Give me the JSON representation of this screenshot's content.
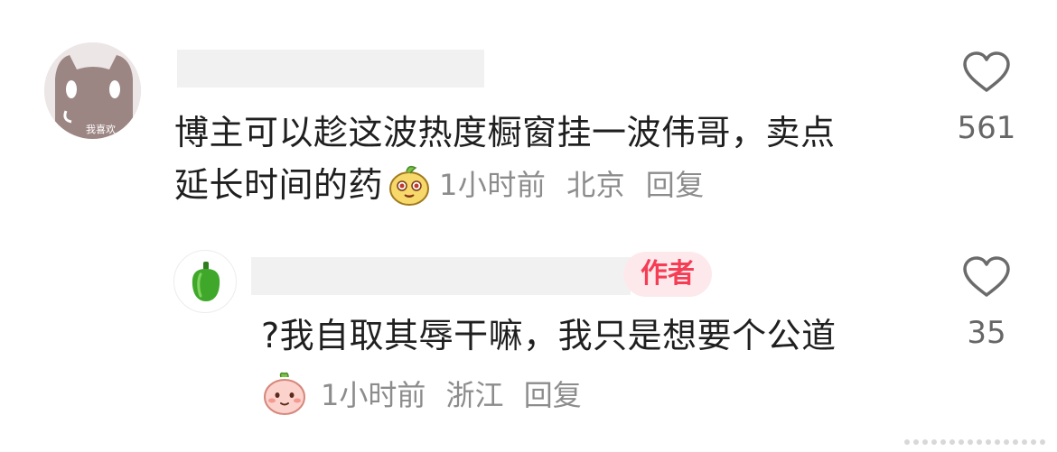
{
  "comments": [
    {
      "avatar_caption": "我喜欢",
      "text_line1": "博主可以趁这波热度橱窗挂一波伟哥，卖点",
      "text_line2": "延长时间的药",
      "emoji": "yellow-blob-emoji",
      "time": "1小时前",
      "location": "北京",
      "reply_label": "回复",
      "like_icon": "heart-outline-icon",
      "like_count": "561"
    },
    {
      "avatar_icon": "green-pepper-icon",
      "badge": "作者",
      "text": "?我自取其辱干嘛，我只是想要个公道",
      "emoji": "pink-blob-emoji",
      "time": "1小时前",
      "location": "浙江",
      "reply_label": "回复",
      "like_icon": "heart-outline-icon",
      "like_count": "35"
    }
  ],
  "colors": {
    "text": "#1f1f1f",
    "meta": "#8c8c8c",
    "badge_text": "#f53d55",
    "badge_bg": "#fde9ec",
    "redaction": "#f1f1f1"
  }
}
